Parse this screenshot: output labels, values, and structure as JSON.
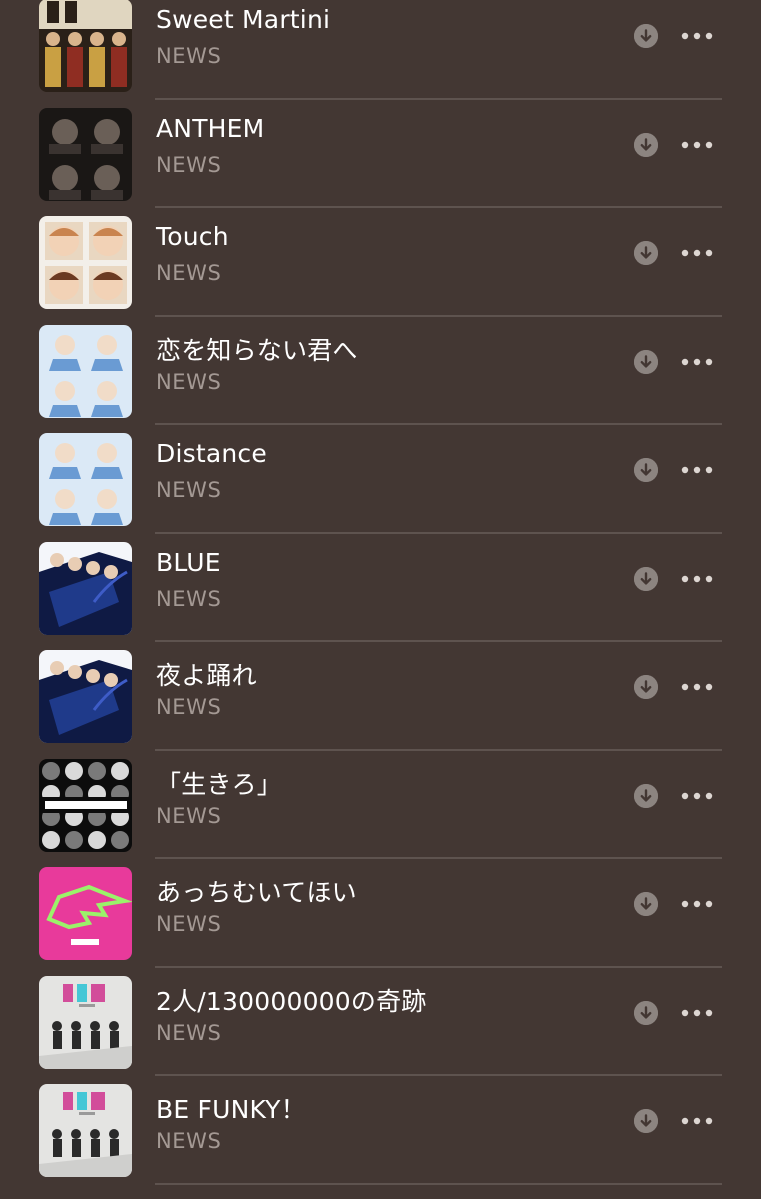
{
  "songs": [
    {
      "title": "Sweet Martini",
      "artist": "NEWS",
      "art_name": "album-art-sweet-martini",
      "art": "mixed-warm",
      "colors": [
        "#2a2018",
        "#c9a043",
        "#8f2d22",
        "#e0d6c0"
      ]
    },
    {
      "title": "ANTHEM",
      "artist": "NEWS",
      "art_name": "album-art-anthem",
      "art": "dark",
      "colors": [
        "#1a1715",
        "#3a3330",
        "#6a5f57",
        "#8a7e74"
      ]
    },
    {
      "title": "Touch",
      "artist": "NEWS",
      "art_name": "album-art-touch",
      "art": "bright-faces",
      "colors": [
        "#f3efe9",
        "#c9844f",
        "#6b3a22",
        "#e9d7c1"
      ]
    },
    {
      "title": "恋を知らない君へ",
      "artist": "NEWS",
      "art_name": "album-art-koi-wo-shiranai-kimi-e",
      "art": "light-blue",
      "colors": [
        "#dbe9f6",
        "#6a9bd3",
        "#2d4f87",
        "#f1dcc8"
      ]
    },
    {
      "title": "Distance",
      "artist": "NEWS",
      "art_name": "album-art-distance",
      "art": "light-blue",
      "colors": [
        "#dbe9f6",
        "#6a9bd3",
        "#2d4f87",
        "#f1dcc8"
      ]
    },
    {
      "title": "BLUE",
      "artist": "NEWS",
      "art_name": "album-art-blue",
      "art": "blue-white",
      "colors": [
        "#f4f6fa",
        "#1f3a8a",
        "#0f1a44",
        "#3e5cc7"
      ]
    },
    {
      "title": "夜よ踊れ",
      "artist": "NEWS",
      "art_name": "album-art-yoru-yo-odore",
      "art": "blue-white",
      "colors": [
        "#f4f6fa",
        "#1f3a8a",
        "#0f1a44",
        "#3e5cc7"
      ]
    },
    {
      "title": "「生きろ」",
      "artist": "NEWS",
      "art_name": "album-art-ikiro",
      "art": "grid-bw",
      "colors": [
        "#0c0c0c",
        "#d9d9d9",
        "#7a7a7a",
        "#ffffff"
      ]
    },
    {
      "title": "あっちむいてほい",
      "artist": "NEWS",
      "art_name": "album-art-acchi-muite-hoi",
      "art": "pink-green",
      "colors": [
        "#e83a9b",
        "#9bf26a",
        "#2b7a2b",
        "#ffffff"
      ]
    },
    {
      "title": "2人/130000000の奇跡",
      "artist": "NEWS",
      "art_name": "album-art-futari-no-kiseki",
      "art": "live-grey",
      "colors": [
        "#e4e4e2",
        "#2a2a2a",
        "#d24d9a",
        "#45c7d6"
      ]
    },
    {
      "title": "BE FUNKY！",
      "artist": "NEWS",
      "art_name": "album-art-be-funky",
      "art": "live-grey",
      "colors": [
        "#e4e4e2",
        "#2a2a2a",
        "#d24d9a",
        "#45c7d6"
      ]
    }
  ],
  "icons": {
    "download": "arrow-down-circle-icon",
    "more": "ellipsis-icon"
  },
  "colors": {
    "background": "#433733",
    "title": "#ffffff",
    "artist": "#a49994",
    "divider": "#5e534f",
    "icon": "#8c8480"
  }
}
